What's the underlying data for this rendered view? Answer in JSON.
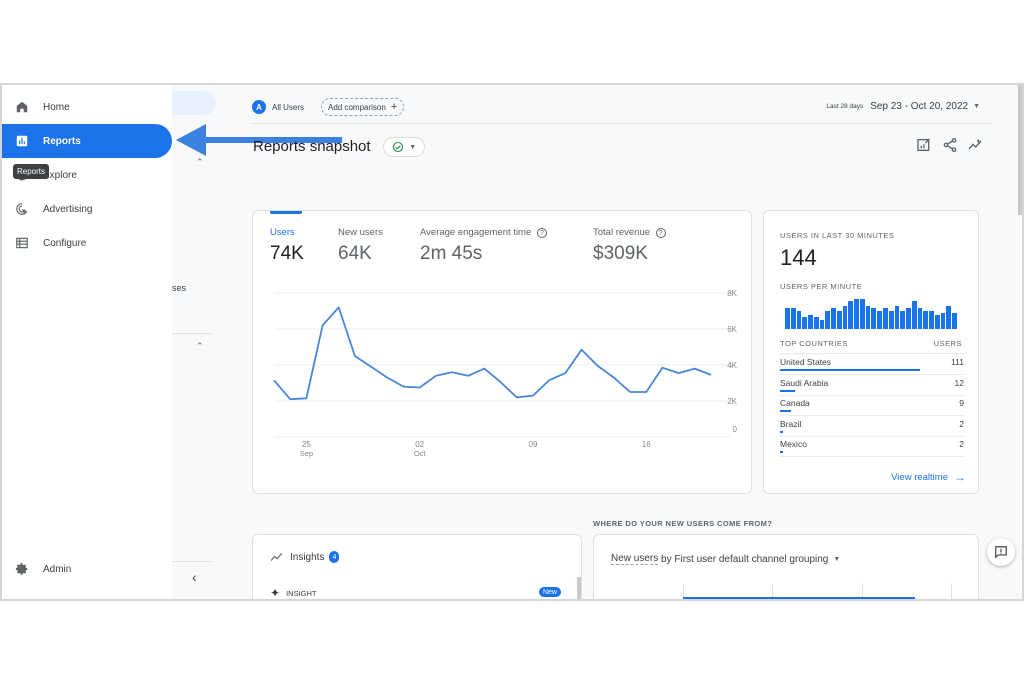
{
  "sidebar": {
    "items": [
      {
        "label": "Home",
        "icon": "home-icon"
      },
      {
        "label": "Reports",
        "icon": "bar-chart-icon",
        "active": true
      },
      {
        "label": "Explore",
        "icon": "explore-icon"
      },
      {
        "label": "Advertising",
        "icon": "advertising-icon"
      },
      {
        "label": "Configure",
        "icon": "list-icon"
      }
    ],
    "tooltip": "Reports",
    "admin_label": "Admin",
    "partial_text": "ses"
  },
  "header": {
    "segment_avatar": "A",
    "segment_label": "All Users",
    "add_comparison": "Add comparison",
    "date_prefix": "Last 28 days",
    "date_range": "Sep 23 - Oct 20, 2022"
  },
  "page": {
    "title": "Reports snapshot"
  },
  "metrics": [
    {
      "label": "Users",
      "value": "74K",
      "active": true
    },
    {
      "label": "New users",
      "value": "64K"
    },
    {
      "label": "Average engagement time",
      "value": "2m 45s",
      "help": true
    },
    {
      "label": "Total revenue",
      "value": "$309K",
      "help": true
    }
  ],
  "realtime": {
    "title": "USERS IN LAST 30 MINUTES",
    "count": "144",
    "per_minute_label": "USERS PER MINUTE",
    "per_minute": [
      9,
      9,
      8,
      5,
      6,
      5,
      4,
      8,
      9,
      8,
      10,
      12,
      13,
      13,
      10,
      9,
      8,
      9,
      8,
      10,
      8,
      9,
      12,
      9,
      8,
      8,
      6,
      7,
      10,
      7
    ],
    "countries_header": "TOP COUNTRIES",
    "users_header": "USERS",
    "countries": [
      {
        "name": "United States",
        "users": 111
      },
      {
        "name": "Saudi Arabia",
        "users": 12
      },
      {
        "name": "Canada",
        "users": 9
      },
      {
        "name": "Brazil",
        "users": 2
      },
      {
        "name": "Mexico",
        "users": 2
      }
    ],
    "link": "View realtime"
  },
  "insights": {
    "title": "Insights",
    "count": "4",
    "item_label": "INSIGHT",
    "new_badge": "New"
  },
  "acquisition": {
    "section_title": "WHERE DO YOUR NEW USERS COME FROM?",
    "card_title_metric": "New users",
    "card_title_rest": " by First user default channel grouping"
  },
  "chart_data": {
    "type": "line",
    "title": "Users",
    "x": [
      "Sep 23",
      "Sep 24",
      "Sep 25",
      "Sep 26",
      "Sep 27",
      "Sep 28",
      "Sep 29",
      "Sep 30",
      "Oct 1",
      "Oct 2",
      "Oct 3",
      "Oct 4",
      "Oct 5",
      "Oct 6",
      "Oct 7",
      "Oct 8",
      "Oct 9",
      "Oct 10",
      "Oct 11",
      "Oct 12",
      "Oct 13",
      "Oct 14",
      "Oct 15",
      "Oct 16",
      "Oct 17",
      "Oct 18",
      "Oct 19",
      "Oct 20"
    ],
    "series": [
      {
        "name": "Users",
        "values": [
          3150,
          2100,
          2150,
          6200,
          7200,
          4500,
          3900,
          3300,
          2800,
          2750,
          3400,
          3600,
          3400,
          3800,
          3050,
          2200,
          2300,
          3150,
          3550,
          4850,
          3950,
          3300,
          2500,
          2500,
          3850,
          3550,
          3800,
          3450
        ]
      }
    ],
    "x_ticks": [
      {
        "index": 2,
        "label": "25",
        "sub": "Sep"
      },
      {
        "index": 9,
        "label": "02",
        "sub": "Oct"
      },
      {
        "index": 16,
        "label": "09",
        "sub": ""
      },
      {
        "index": 23,
        "label": "16",
        "sub": ""
      }
    ],
    "y_ticks": [
      "0",
      "2K",
      "4K",
      "6K",
      "8K"
    ],
    "ylim": [
      0,
      8000
    ],
    "grid": true,
    "y_axis_side": "right",
    "color": "#4a86d8"
  }
}
